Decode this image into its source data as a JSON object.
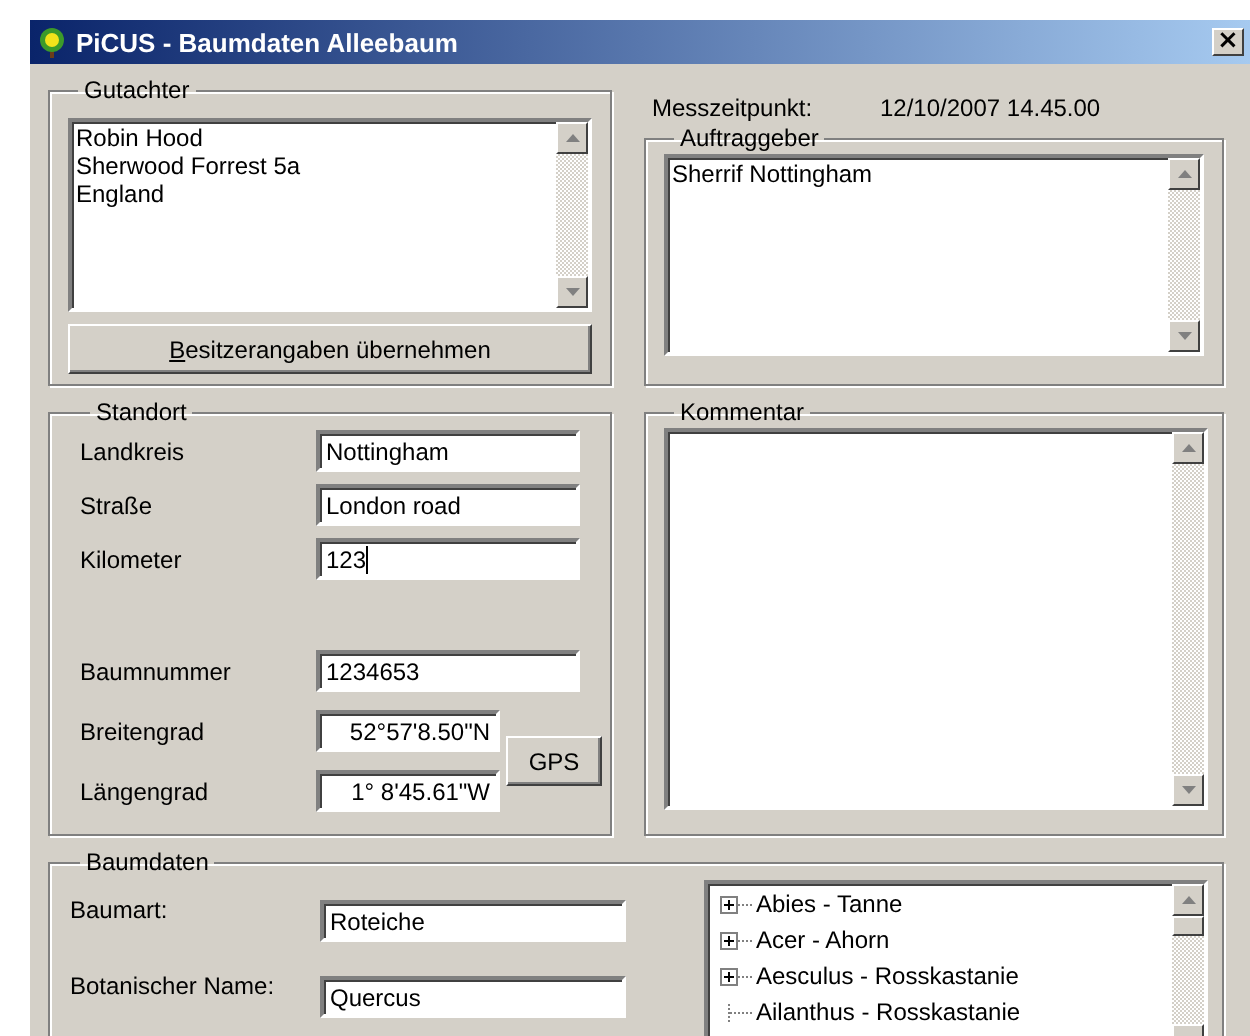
{
  "window": {
    "title": "PiCUS - Baumdaten Alleebaum",
    "close": "×"
  },
  "gutachter": {
    "label": "Gutachter",
    "lines": [
      "Robin Hood",
      "Sherwood Forrest 5a",
      "England"
    ],
    "button": {
      "label": "Besitzerangaben übernehmen",
      "mnemonic": true
    }
  },
  "messzeitpunkt": {
    "label": "Messzeitpunkt:",
    "value": "12/10/2007 14.45.00"
  },
  "auftraggeber": {
    "label": "Auftraggeber",
    "lines": [
      "Sherrif Nottingham"
    ]
  },
  "standort": {
    "label": "Standort",
    "fields": [
      {
        "label": "Landkreis",
        "value": "Nottingham",
        "focused": false
      },
      {
        "label": "Straße",
        "value": "London road",
        "focused": false
      },
      {
        "label": "Kilometer",
        "value": "123",
        "focused": true
      },
      {
        "label": "Baumnummer",
        "value": "1234653",
        "focused": false
      }
    ],
    "coordinates": [
      {
        "label": "Breitengrad",
        "value": "52°57'8.50\"N"
      },
      {
        "label": "Längengrad",
        "value": "1° 8'45.61\"W"
      }
    ],
    "gps_button": "GPS"
  },
  "kommentar": {
    "label": "Kommentar"
  },
  "baumdaten": {
    "label": "Baumdaten",
    "fields": [
      {
        "label": "Baumart:",
        "value": "Roteiche"
      },
      {
        "label": "Botanischer Name:",
        "value": "Quercus"
      }
    ],
    "species_tree": [
      {
        "label": "Abies - Tanne",
        "kind": "branch",
        "expanded": false
      },
      {
        "label": "Acer - Ahorn",
        "kind": "branch",
        "expanded": false
      },
      {
        "label": "Aesculus - Rosskastanie",
        "kind": "branch",
        "expanded": false
      },
      {
        "label": "Ailanthus - Rosskastanie",
        "kind": "leaf"
      }
    ]
  }
}
